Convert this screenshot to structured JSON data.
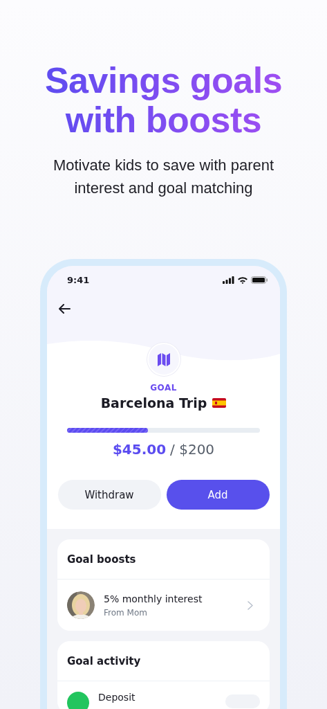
{
  "headline": "Savings goals with boosts",
  "subtitle": "Motivate kids to save with parent interest and goal matching",
  "status_bar": {
    "time": "9:41"
  },
  "goal": {
    "label": "GOAL",
    "title": "Barcelona Trip",
    "progress": {
      "level": 0.42
    },
    "saved": "$45.00",
    "target": "/ $200"
  },
  "buttons": [
    {
      "label": "Withdraw",
      "kind": "secondary"
    },
    {
      "label": "Add",
      "kind": "primary"
    }
  ],
  "boosts": {
    "title": "Goal boosts",
    "items": [
      {
        "title": "5% monthly interest",
        "subtitle": "From Mom"
      }
    ]
  },
  "activity": {
    "title": "Goal activity",
    "items": [
      {
        "title": "Deposit",
        "color": "#22c55e"
      }
    ]
  }
}
